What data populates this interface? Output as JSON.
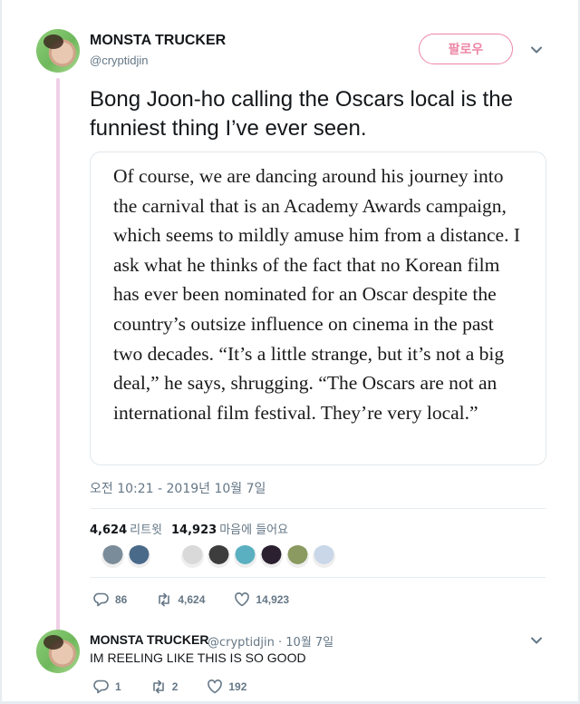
{
  "tweet": {
    "author_name": "MONSTA TRUCKER",
    "author_handle": "@cryptidjin",
    "follow_label": "팔로우",
    "text": "Bong Joon-ho calling the Oscars local is the funniest thing I’ve ever seen.",
    "quote_text": "Of course, we are dancing around his journey into the carnival that is an Academy Awards campaign, which seems to mildly amuse him from a distance. I ask what he thinks of the fact that no Korean film has ever been nominated for an Oscar despite the country’s outsize influence on cinema in the past two decades. “It’s a little strange, but it’s not a big deal,” he says, shrugging. “The Oscars are not an international film festival. They’re very local.”",
    "timestamp": "오전 10:21 - 2019년 10월 7일",
    "retweets_count": "4,624",
    "retweets_label": "리트윗",
    "likes_count": "14,923",
    "likes_label": "마음에 들어요",
    "actions": {
      "replies": "86",
      "retweets": "4,624",
      "likes": "14,923"
    }
  },
  "likers": [
    "#7a8c99",
    "#4a6a8a",
    "#d9d9d9",
    "#3d3d3d",
    "#5ab0c0",
    "#2a2030",
    "#8a9a60",
    "#c9d7e8"
  ],
  "reply": {
    "author_name": "MONSTA TRUCKER",
    "author_handle": "@cryptidjin",
    "date": "· 10월 7일",
    "text": "IM REELING LIKE THIS IS SO GOOD",
    "actions": {
      "replies": "1",
      "retweets": "2",
      "likes": "192"
    }
  },
  "icons": [
    "chevron-down-icon",
    "reply-icon",
    "retweet-icon",
    "heart-icon"
  ],
  "colors": {
    "accent": "#e0245e",
    "thread_line": "#f0cfe6",
    "muted": "#657786"
  }
}
